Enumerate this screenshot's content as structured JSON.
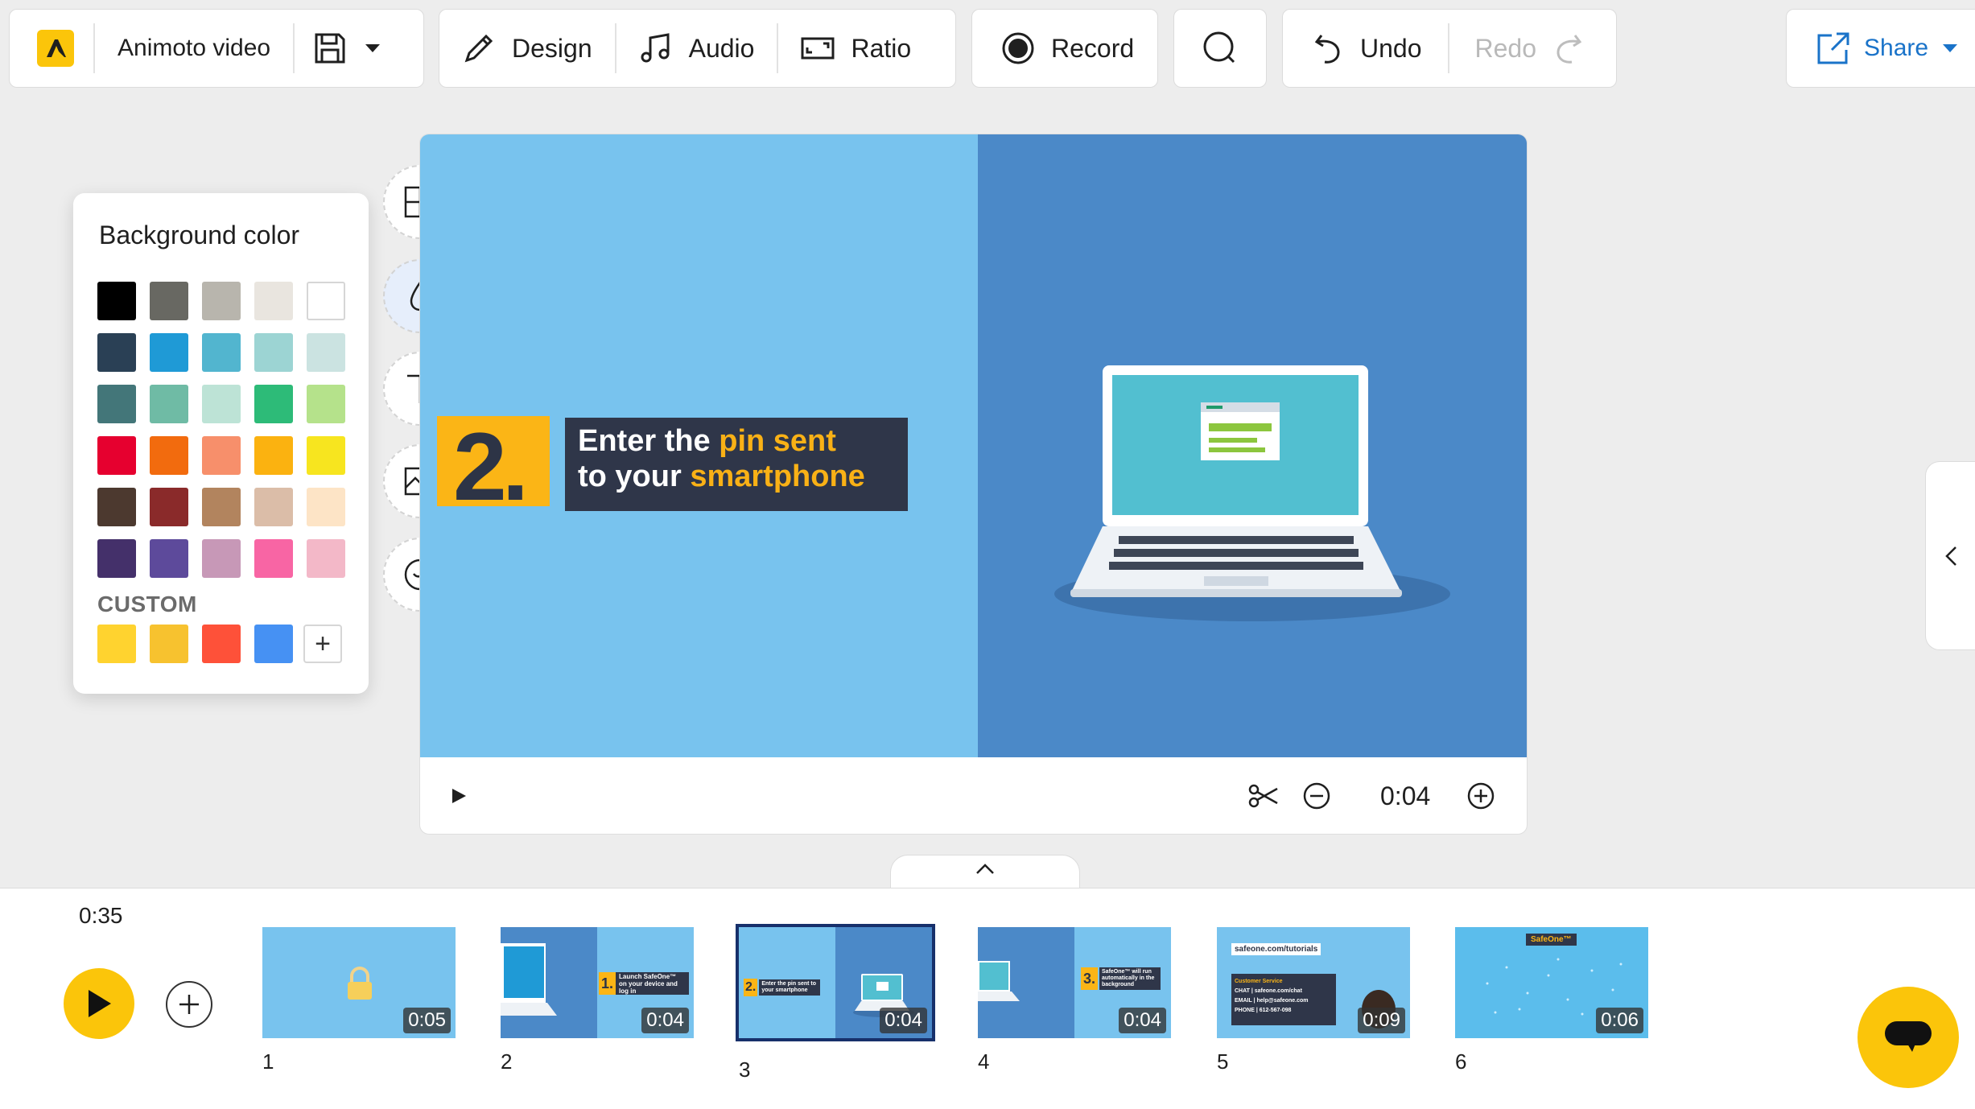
{
  "toolbar": {
    "project_name": "Animoto video",
    "design_label": "Design",
    "audio_label": "Audio",
    "ratio_label": "Ratio",
    "record_label": "Record",
    "undo_label": "Undo",
    "redo_label": "Redo",
    "share_label": "Share"
  },
  "color_panel": {
    "title": "Background color",
    "custom_label": "CUSTOM",
    "add_symbol": "+",
    "palette": [
      [
        "#000000",
        "#686862",
        "#b8b5ad",
        "#e9e5df",
        "#ffffff"
      ],
      [
        "#2a4055",
        "#1f9ad6",
        "#52b5cf",
        "#9cd4d3",
        "#cbe3e1"
      ],
      [
        "#437679",
        "#6fbba5",
        "#bde3d6",
        "#2dbb78",
        "#b5e28b"
      ],
      [
        "#e6002f",
        "#f26b0e",
        "#f78f6b",
        "#fbb210",
        "#f7e51f"
      ],
      [
        "#4c392f",
        "#8a2a2a",
        "#b2845e",
        "#dbbda8",
        "#fde4c6"
      ],
      [
        "#44306a",
        "#5d4a9b",
        "#c798b7",
        "#f865a4",
        "#f3b8c8"
      ]
    ],
    "custom_colors": [
      "#ffd32f",
      "#f7c22f",
      "#fe5139",
      "#4691f3"
    ]
  },
  "scene": {
    "step_number": "2.",
    "line1_white": "Enter the ",
    "line1_highlight": "pin sent",
    "line2_white": "to your ",
    "line2_highlight": "smartphone",
    "colors": {
      "left_bg": "#78c3ee",
      "right_bg": "#4b89c8",
      "accent": "#fbb516",
      "box": "#2f3649"
    }
  },
  "player": {
    "duration": "0:04"
  },
  "timeline": {
    "total_time": "0:35",
    "scenes": [
      {
        "number": "1",
        "duration": "0:05"
      },
      {
        "number": "2",
        "duration": "0:04"
      },
      {
        "number": "3",
        "duration": "0:04",
        "selected": true
      },
      {
        "number": "4",
        "duration": "0:04"
      },
      {
        "number": "5",
        "duration": "0:09"
      },
      {
        "number": "6",
        "duration": "0:06"
      }
    ]
  },
  "thumb_text": {
    "t2_title": "Launch SafeOne™ on your device and log in",
    "t2_num": "1.",
    "t3_title": "Enter the pin sent to your smartphone",
    "t3_num": "2.",
    "t4_title": "SafeOne™ will run automatically in the background",
    "t4_num": "3.",
    "t5_url": "safeone.com/tutorials",
    "t5_service": "Customer Service",
    "t5_chat": "CHAT | safeone.com/chat",
    "t5_email": "EMAIL | help@safeone.com",
    "t5_phone": "PHONE | 612-567-098",
    "t6_brand": "SafeOne™"
  },
  "icons": {
    "logo": "animoto-logo-icon",
    "save": "save-icon",
    "design": "pen-icon",
    "audio": "music-note-icon",
    "ratio": "ratio-icon",
    "record": "record-icon",
    "search": "search-icon",
    "undo": "undo-icon",
    "redo": "redo-icon",
    "share": "share-icon"
  },
  "accent_colors": {
    "brand_yellow": "#fbc50a",
    "link_blue": "#1a73c9"
  }
}
